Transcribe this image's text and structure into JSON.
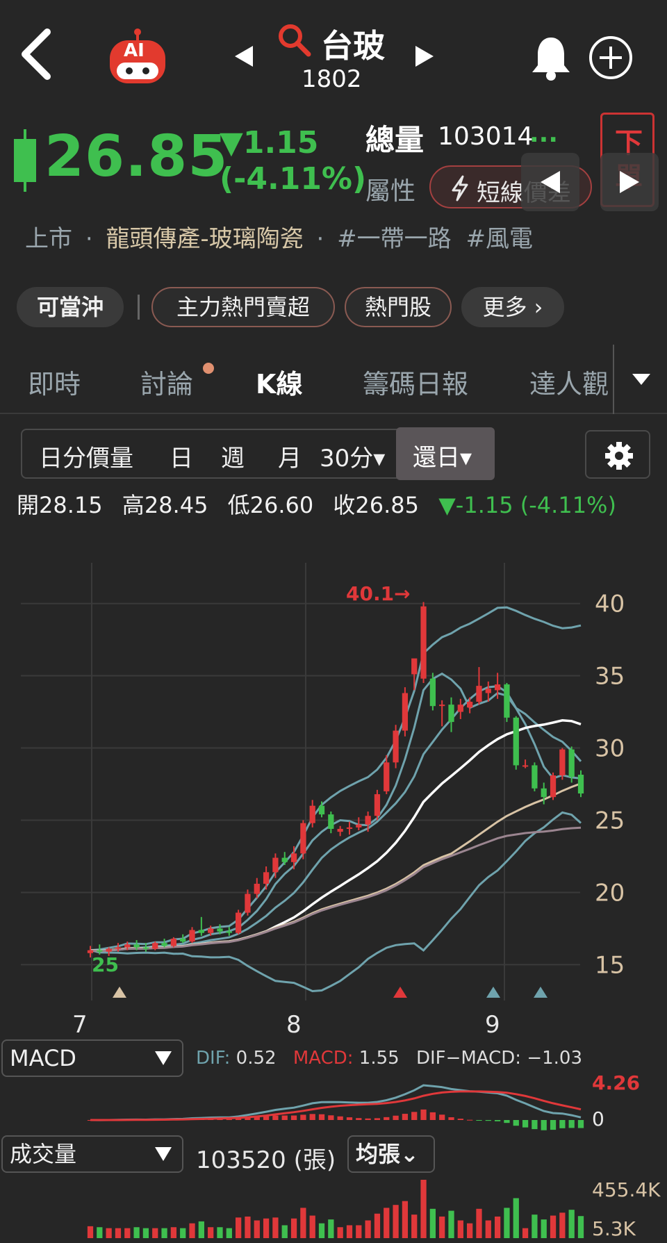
{
  "header": {
    "stock_name": "台玻",
    "stock_code": "1802",
    "ai_label": "AI"
  },
  "quote": {
    "price": "26.85",
    "change": "▼1.15",
    "change_pct": "(-4.11%)",
    "volume_label": "總量",
    "volume_value": "103014",
    "volume_more": "...",
    "attr_label": "屬性",
    "attr_value": "短線價差",
    "order_button": "下單"
  },
  "tags_line": {
    "market": "上市",
    "sep": "·",
    "industry": "龍頭傳產-玻璃陶瓷",
    "tags": [
      "#一帶一路",
      "#風電"
    ]
  },
  "chips": [
    {
      "label": "可當沖"
    },
    {
      "label": "主力熱門賣超"
    },
    {
      "label": "熱門股"
    },
    {
      "label": "更多 ›"
    }
  ],
  "tabs": [
    {
      "label": "即時"
    },
    {
      "label": "討論"
    },
    {
      "label": "K線"
    },
    {
      "label": "籌碼日報"
    },
    {
      "label": "達人觀"
    }
  ],
  "periods": [
    {
      "label": "日分價量"
    },
    {
      "label": "日"
    },
    {
      "label": "週"
    },
    {
      "label": "月"
    },
    {
      "label": "30分▾"
    },
    {
      "label": "還日▾"
    }
  ],
  "ohlc": {
    "open_label": "開",
    "open": "28.15",
    "high_label": "高",
    "high": "28.45",
    "low_label": "低",
    "low": "26.60",
    "close_label": "收",
    "close": "26.85",
    "change": "▼-1.15 (-4.11%)"
  },
  "colors": {
    "up": "#e0383a",
    "down": "#3fbf4f",
    "bb": "#6fa3ad",
    "ma_white": "#ffffff",
    "ma_beige": "#d8c3a5",
    "ma_mauve": "#9b8590"
  },
  "chart_data": {
    "type": "candlestick",
    "y_ticks": [
      "40",
      "35",
      "30",
      "25",
      "20",
      "15"
    ],
    "ylim": [
      13,
      42
    ],
    "x_ticks": [
      "7",
      "8",
      "9"
    ],
    "max_marker": "40.1→",
    "min_marker": "25",
    "candles": [
      {
        "o": 15.8,
        "h": 16.3,
        "l": 15.5,
        "c": 16.0
      },
      {
        "o": 16.0,
        "h": 16.4,
        "l": 15.7,
        "c": 15.9
      },
      {
        "o": 15.9,
        "h": 16.2,
        "l": 15.6,
        "c": 16.1
      },
      {
        "o": 16.1,
        "h": 16.5,
        "l": 15.9,
        "c": 16.2
      },
      {
        "o": 16.2,
        "h": 16.6,
        "l": 16.0,
        "c": 16.4
      },
      {
        "o": 16.4,
        "h": 16.7,
        "l": 16.0,
        "c": 16.2
      },
      {
        "o": 16.2,
        "h": 16.5,
        "l": 15.9,
        "c": 16.1
      },
      {
        "o": 16.1,
        "h": 16.6,
        "l": 16.0,
        "c": 16.5
      },
      {
        "o": 16.5,
        "h": 16.8,
        "l": 16.2,
        "c": 16.3
      },
      {
        "o": 16.3,
        "h": 16.9,
        "l": 16.2,
        "c": 16.8
      },
      {
        "o": 16.8,
        "h": 17.1,
        "l": 16.5,
        "c": 16.6
      },
      {
        "o": 16.6,
        "h": 17.6,
        "l": 16.5,
        "c": 17.4
      },
      {
        "o": 17.4,
        "h": 18.3,
        "l": 17.0,
        "c": 17.2
      },
      {
        "o": 17.2,
        "h": 17.7,
        "l": 17.0,
        "c": 17.5
      },
      {
        "o": 17.5,
        "h": 17.8,
        "l": 17.1,
        "c": 17.3
      },
      {
        "o": 17.3,
        "h": 17.6,
        "l": 17.0,
        "c": 17.2
      },
      {
        "o": 17.2,
        "h": 18.8,
        "l": 17.1,
        "c": 18.6
      },
      {
        "o": 18.6,
        "h": 20.2,
        "l": 18.4,
        "c": 19.9
      },
      {
        "o": 19.9,
        "h": 21.0,
        "l": 19.6,
        "c": 20.6
      },
      {
        "o": 20.6,
        "h": 21.8,
        "l": 20.2,
        "c": 21.4
      },
      {
        "o": 21.4,
        "h": 22.7,
        "l": 21.0,
        "c": 22.4
      },
      {
        "o": 22.4,
        "h": 22.8,
        "l": 21.9,
        "c": 22.1
      },
      {
        "o": 22.1,
        "h": 23.2,
        "l": 21.6,
        "c": 22.7
      },
      {
        "o": 22.7,
        "h": 25.0,
        "l": 22.3,
        "c": 24.8
      },
      {
        "o": 24.8,
        "h": 26.4,
        "l": 24.5,
        "c": 26.0
      },
      {
        "o": 26.0,
        "h": 26.3,
        "l": 25.2,
        "c": 25.4
      },
      {
        "o": 25.4,
        "h": 25.6,
        "l": 24.1,
        "c": 24.4
      },
      {
        "o": 24.2,
        "h": 24.6,
        "l": 23.9,
        "c": 24.4
      },
      {
        "o": 24.4,
        "h": 24.9,
        "l": 24.0,
        "c": 24.5
      },
      {
        "o": 24.5,
        "h": 25.2,
        "l": 24.3,
        "c": 24.7
      },
      {
        "o": 24.7,
        "h": 25.6,
        "l": 24.2,
        "c": 25.3
      },
      {
        "o": 25.3,
        "h": 27.1,
        "l": 25.0,
        "c": 26.8
      },
      {
        "o": 27.0,
        "h": 29.5,
        "l": 26.8,
        "c": 29.0
      },
      {
        "o": 29.0,
        "h": 31.6,
        "l": 28.6,
        "c": 31.2
      },
      {
        "o": 31.2,
        "h": 34.2,
        "l": 30.8,
        "c": 33.8
      },
      {
        "o": 35.1,
        "h": 36.0,
        "l": 34.0,
        "c": 36.2
      },
      {
        "o": 34.8,
        "h": 40.1,
        "l": 34.5,
        "c": 39.8
      },
      {
        "o": 34.8,
        "h": 35.2,
        "l": 32.6,
        "c": 32.9
      },
      {
        "o": 33.0,
        "h": 33.3,
        "l": 31.5,
        "c": 33.0
      },
      {
        "o": 33.0,
        "h": 33.5,
        "l": 31.1,
        "c": 31.8
      },
      {
        "o": 32.5,
        "h": 33.4,
        "l": 32.0,
        "c": 33.0
      },
      {
        "o": 32.8,
        "h": 33.5,
        "l": 32.4,
        "c": 33.2
      },
      {
        "o": 33.2,
        "h": 35.6,
        "l": 33.0,
        "c": 34.3
      },
      {
        "o": 33.8,
        "h": 34.6,
        "l": 33.2,
        "c": 34.1
      },
      {
        "o": 34.0,
        "h": 35.2,
        "l": 33.4,
        "c": 34.4
      },
      {
        "o": 34.4,
        "h": 34.5,
        "l": 31.8,
        "c": 32.1
      },
      {
        "o": 32.1,
        "h": 32.2,
        "l": 28.5,
        "c": 28.8
      },
      {
        "o": 28.8,
        "h": 29.2,
        "l": 28.6,
        "c": 28.8
      },
      {
        "o": 28.8,
        "h": 29.0,
        "l": 27.0,
        "c": 27.2
      },
      {
        "o": 27.2,
        "h": 27.6,
        "l": 26.1,
        "c": 26.6
      },
      {
        "o": 26.6,
        "h": 28.3,
        "l": 26.4,
        "c": 28.1
      },
      {
        "o": 28.1,
        "h": 30.0,
        "l": 27.8,
        "c": 29.9
      },
      {
        "o": 29.9,
        "h": 30.1,
        "l": 27.6,
        "c": 28.0
      },
      {
        "o": 28.15,
        "h": 28.45,
        "l": 26.6,
        "c": 26.85
      }
    ],
    "macd": {
      "dif_label": "DIF:",
      "dif": "0.52",
      "macd_label": "MACD:",
      "macd": "1.55",
      "osc_label": "DIF−MACD:",
      "osc": "−1.03",
      "top_tick": "4.26",
      "zero_tick": "0"
    },
    "volume": {
      "value": "103520 (張)",
      "top_tick": "455.4K",
      "bottom_tick": "5.3K"
    }
  },
  "indicators": {
    "macd_select": "MACD",
    "volume_select": "成交量",
    "avg_select": "均張⌄"
  }
}
